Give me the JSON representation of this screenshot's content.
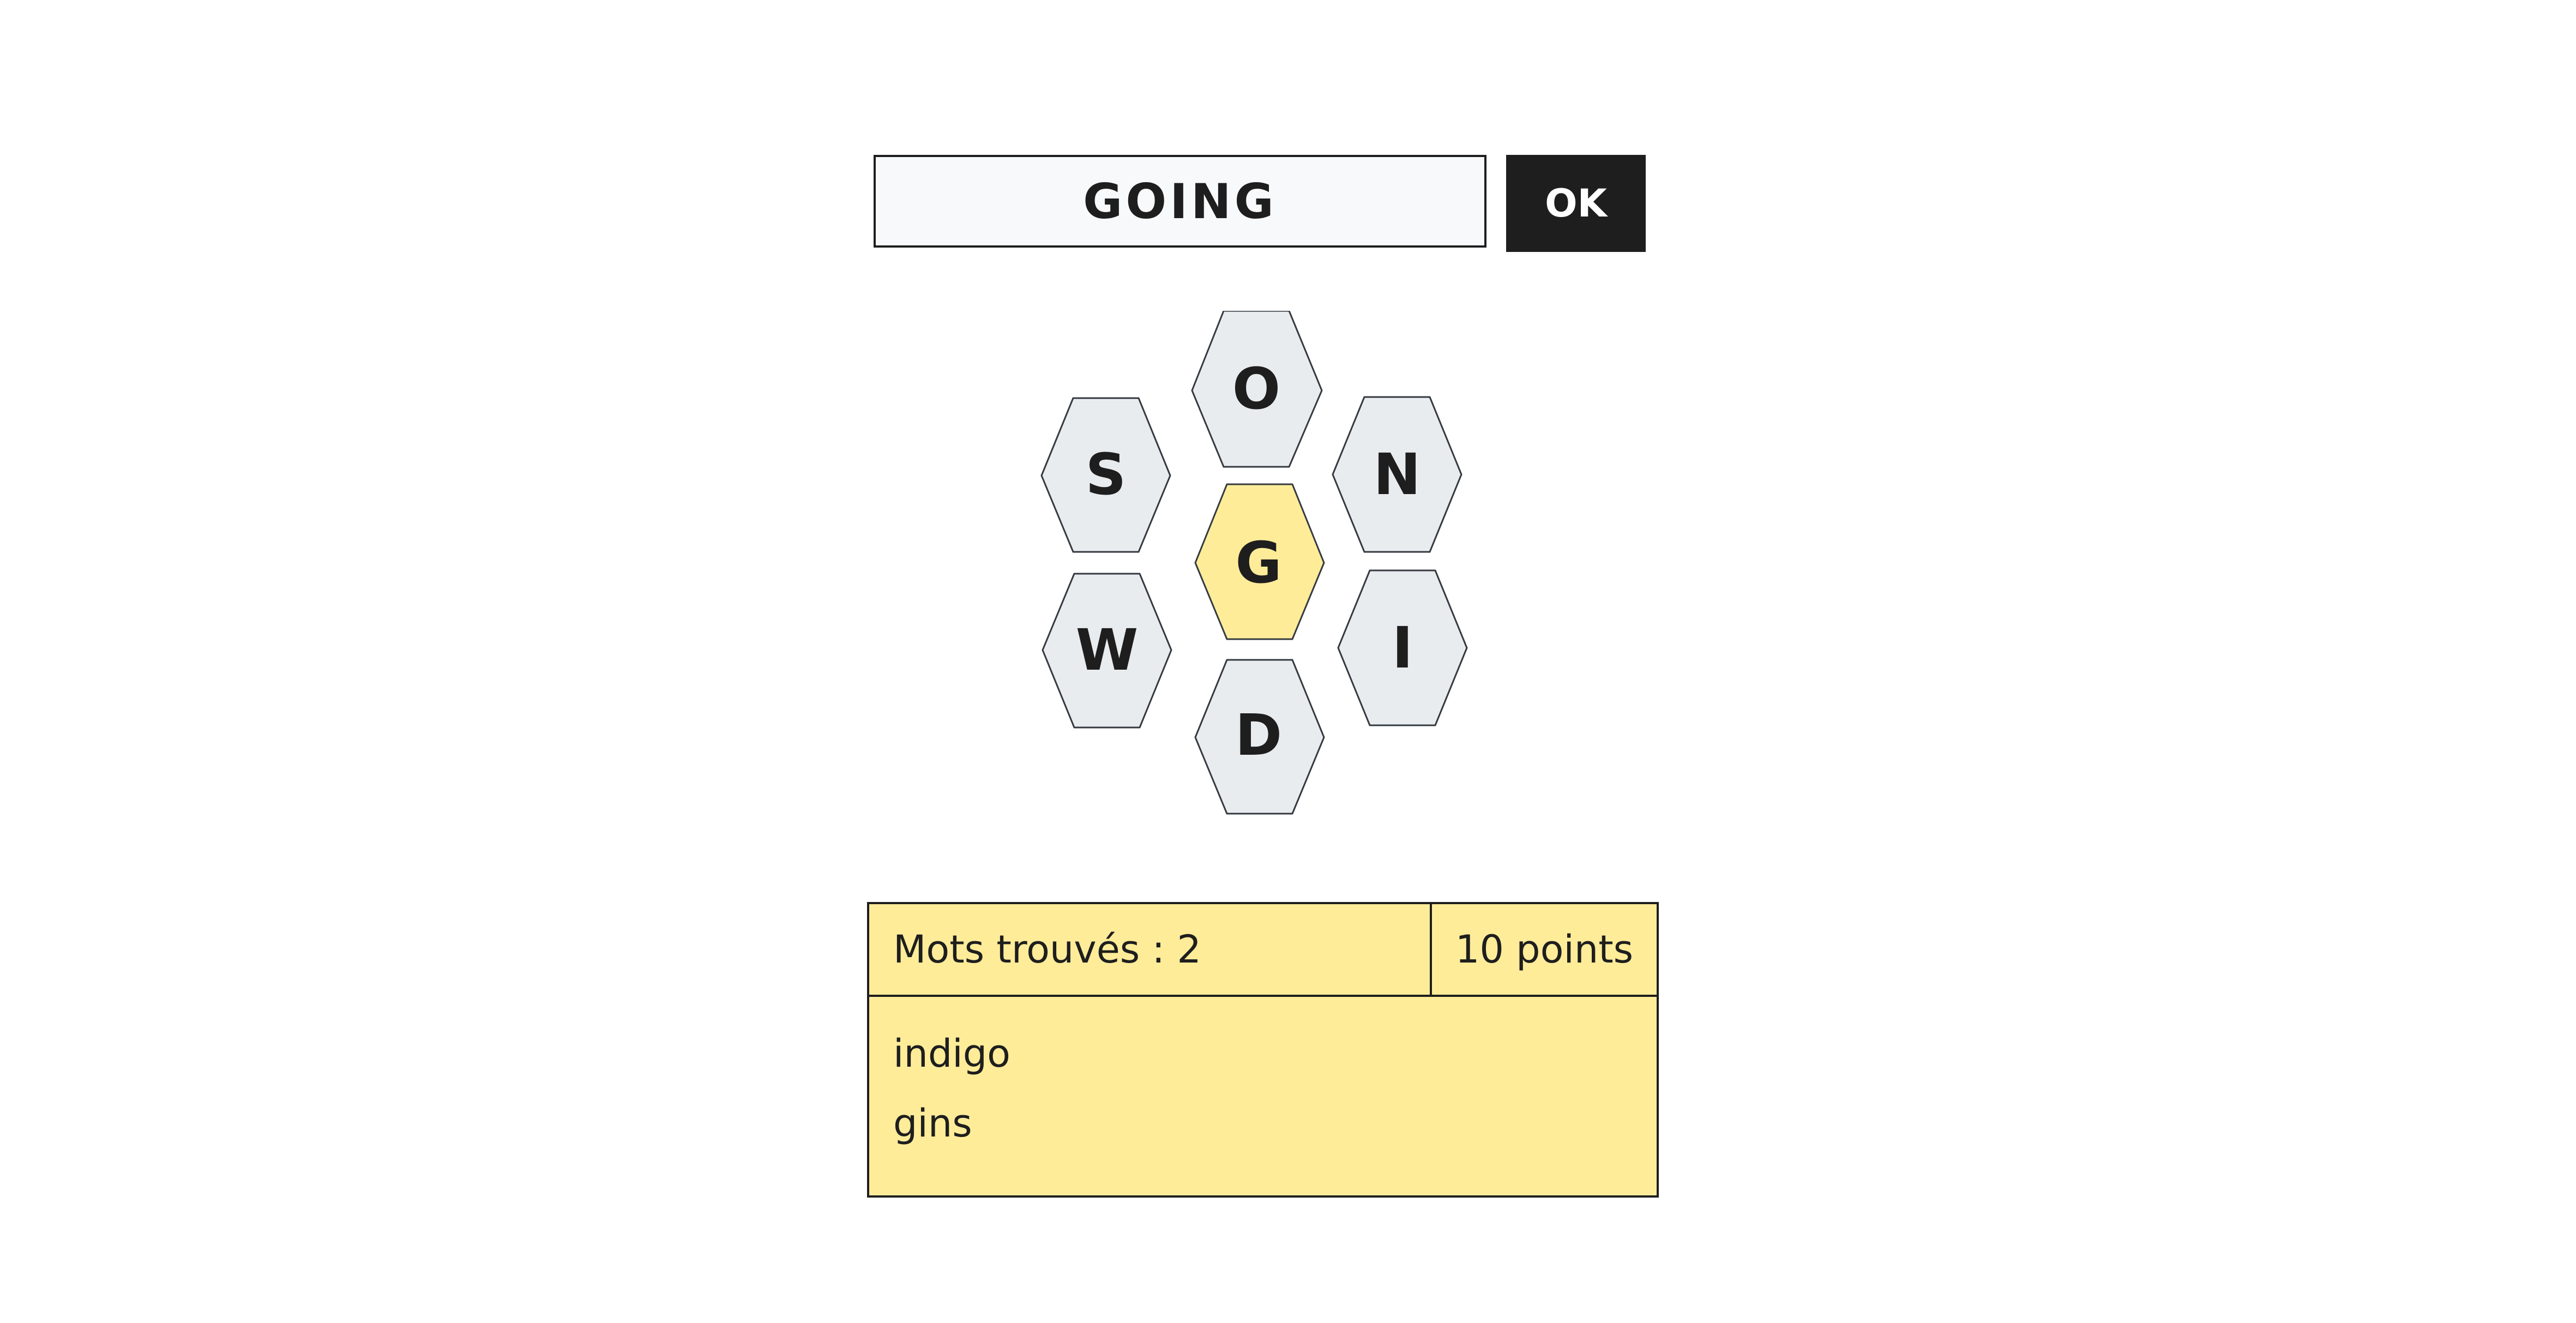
{
  "input": {
    "current_word": "GOING",
    "submit_label": "OK"
  },
  "hive": {
    "center_letter": "G",
    "outer_letters": [
      "O",
      "N",
      "I",
      "D",
      "W",
      "S"
    ],
    "center_color": "#ffec99",
    "outer_color": "#e9ecef"
  },
  "results": {
    "found_label": "Mots trouvés : 2",
    "score_label": "10 points",
    "words": [
      "indigo",
      "gins"
    ],
    "panel_color": "#ffec99"
  }
}
